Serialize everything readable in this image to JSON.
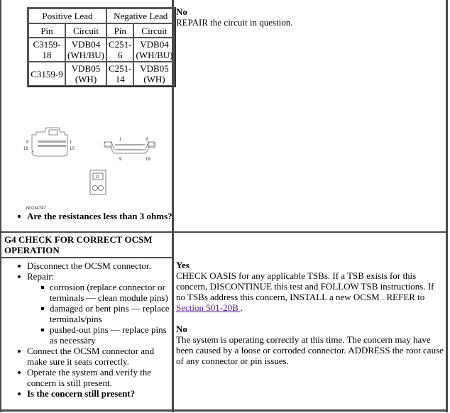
{
  "pin_table": {
    "group_headers": [
      "Positive Lead",
      "Negative Lead"
    ],
    "column_headers": [
      "Pin",
      "Circuit",
      "Pin",
      "Circuit"
    ],
    "rows": [
      {
        "pos_pin": "C3159-18",
        "pos_circuit": "VDB04 (WH/BU)",
        "neg_pin": "C251-6",
        "neg_circuit": "VDB04 (WH/BU)"
      },
      {
        "pos_pin": "C3159-9",
        "pos_circuit": "VDB05 (WH)",
        "neg_pin": "C251-14",
        "neg_circuit": "VDB05 (WH)"
      }
    ]
  },
  "figure": {
    "connector_a_pins": {
      "top_left": "9",
      "top_right": "1",
      "bottom_left": "18",
      "bottom_right": "10"
    },
    "connector_b_pins": {
      "top_left": "1",
      "top_right": "8",
      "bottom_left": "9",
      "bottom_right": "16"
    },
    "meter_symbol": "Ω",
    "figure_id": "N0134747",
    "icons": [
      "connector-c3159-icon",
      "dlc-connector-c251-icon",
      "ohmmeter-icon"
    ]
  },
  "g3_question": "Are the resistances less than 3 ohms?",
  "g3_no": {
    "label": "No",
    "text": "REPAIR the circuit in question."
  },
  "g4": {
    "heading": "G4 CHECK FOR CORRECT OCSM OPERATION",
    "steps": [
      "Disconnect the OCSM connector.",
      "Repair:",
      "Connect the OCSM connector and make sure it seats correctly.",
      "Operate the system and verify the concern is still present."
    ],
    "repair_items": [
      "corrosion (replace connector or terminals — clean module pins)",
      "damaged or bent pins — replace terminals/pins",
      "pushed-out pins — replace pins as necessary"
    ],
    "question": "Is the concern still present?",
    "yes": {
      "label": "Yes",
      "text": "CHECK OASIS for any applicable TSBs. If a TSB exists for this concern, DISCONTINUE this test and FOLLOW TSB instructions. If no TSBs address this concern, INSTALL a new OCSM . REFER to ",
      "link": "Section 501-20B ",
      "tail": "."
    },
    "no": {
      "label": "No",
      "text": "The system is operating correctly at this time. The concern may have been caused by a loose or corroded connector. ADDRESS the root cause of any connector or pin issues."
    }
  }
}
